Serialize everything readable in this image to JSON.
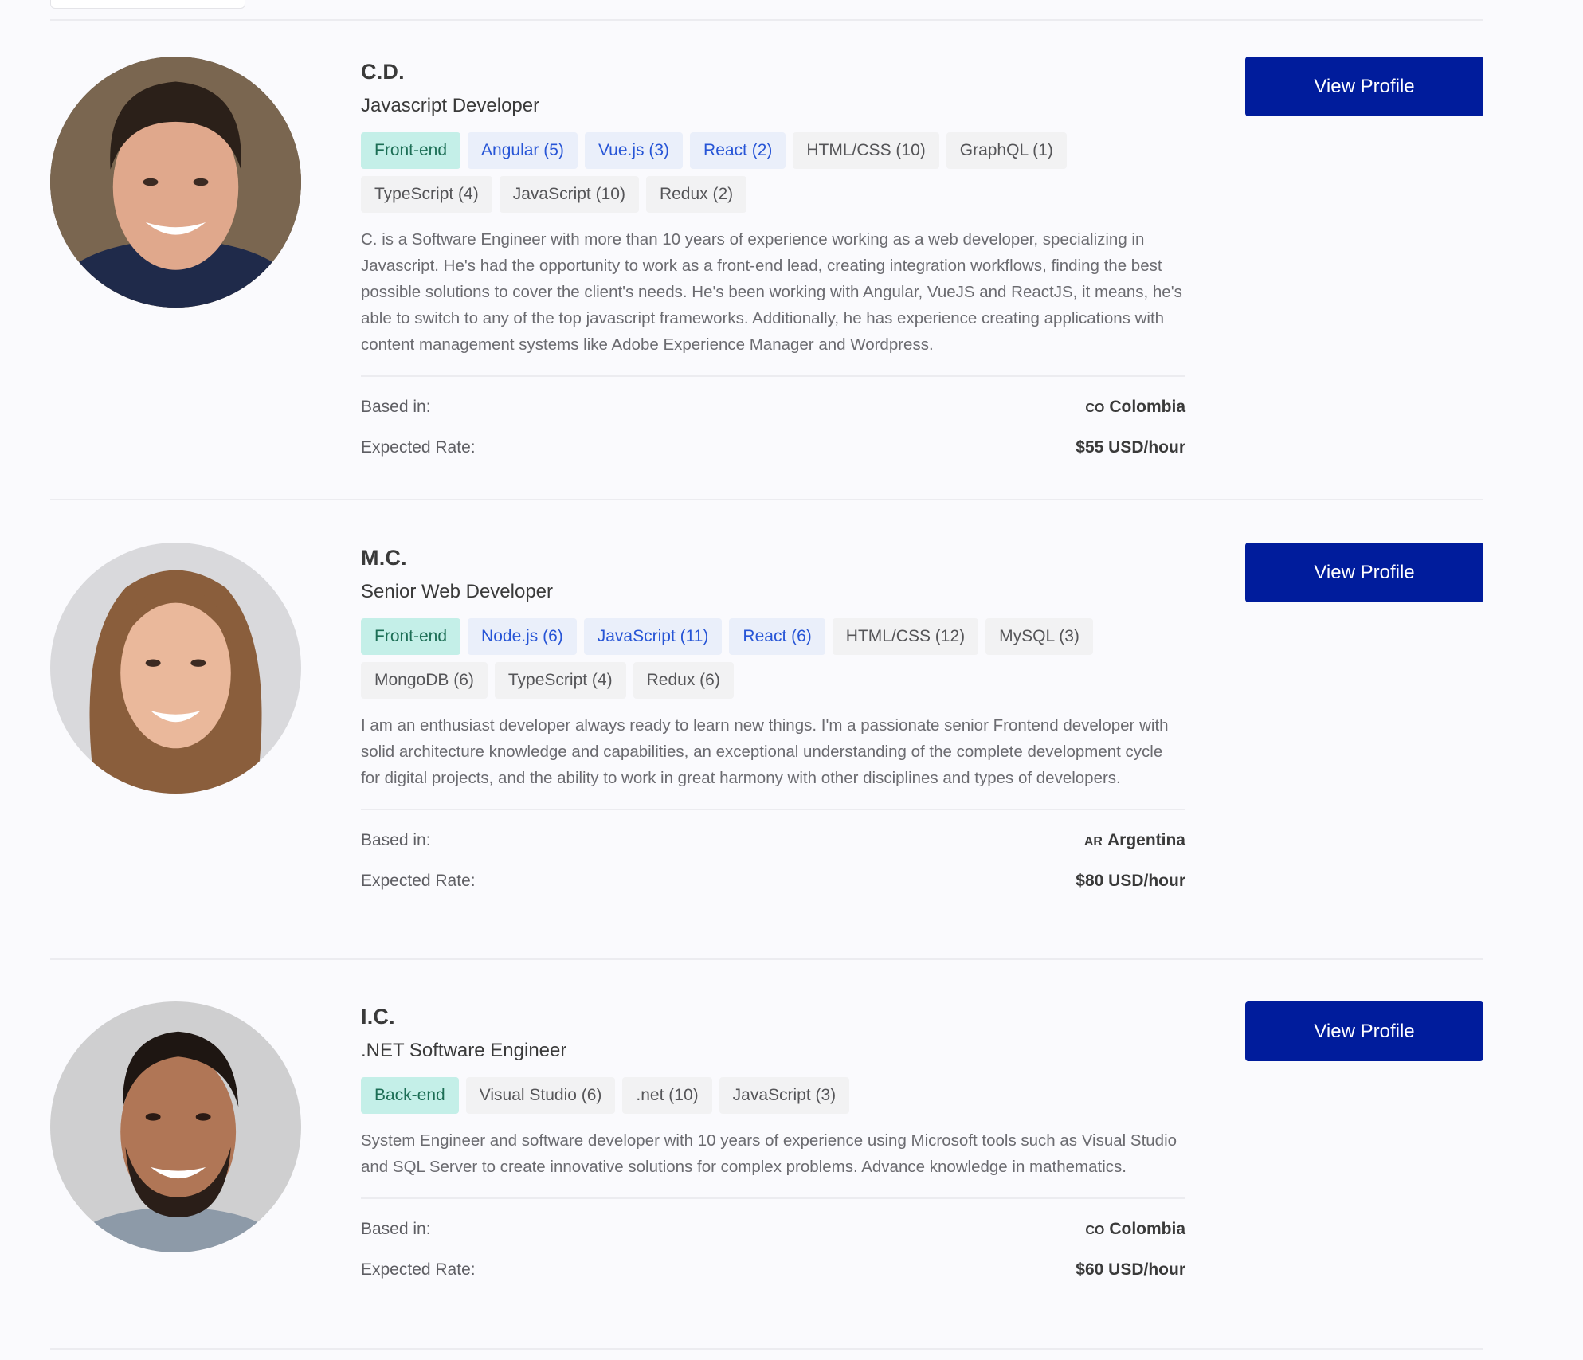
{
  "colors": {
    "button_bg": "#001c9c",
    "category_tag_bg": "#c4efe8",
    "category_tag_text": "#1c6e55",
    "highlight_tag_bg": "#eaeffa",
    "highlight_tag_text": "#2755d6",
    "standard_tag_bg": "#f2f2f3"
  },
  "labels": {
    "based_in": "Based in:",
    "expected_rate": "Expected Rate:",
    "view_profile": "View Profile"
  },
  "candidates": [
    {
      "name": "C.D.",
      "title": "Javascript Developer",
      "avatar": "avatar-photo-man-dark-hair",
      "tags": [
        {
          "label": "Front-end",
          "kind": "cat"
        },
        {
          "label": "Angular (5)",
          "kind": "hl"
        },
        {
          "label": "Vue.js (3)",
          "kind": "hl"
        },
        {
          "label": "React (2)",
          "kind": "hl"
        },
        {
          "label": "HTML/CSS (10)",
          "kind": "std"
        },
        {
          "label": "GraphQL (1)",
          "kind": "std"
        },
        {
          "label": "TypeScript (4)",
          "kind": "std"
        },
        {
          "label": "JavaScript (10)",
          "kind": "std"
        },
        {
          "label": "Redux (2)",
          "kind": "std"
        }
      ],
      "bio": "C. is a Software Engineer with more than 10 years of experience working as a web developer, specializing in Javascript. He's had the opportunity to work as a front-end lead, creating integration workflows, finding the best possible solutions to cover the client's needs. He's been working with Angular, VueJS and ReactJS, it means, he's able to switch to any of the top javascript frameworks. Additionally, he has experience creating applications with content management systems like Adobe Experience Manager and Wordpress.",
      "country_code": "CO",
      "country": "Colombia",
      "rate": "$55 USD/hour"
    },
    {
      "name": "M.C.",
      "title": "Senior Web Developer",
      "avatar": "avatar-photo-woman-brown-hair",
      "tags": [
        {
          "label": "Front-end",
          "kind": "cat"
        },
        {
          "label": "Node.js (6)",
          "kind": "hl"
        },
        {
          "label": "JavaScript (11)",
          "kind": "hl"
        },
        {
          "label": "React (6)",
          "kind": "hl"
        },
        {
          "label": "HTML/CSS (12)",
          "kind": "std"
        },
        {
          "label": "MySQL (3)",
          "kind": "std"
        },
        {
          "label": "MongoDB (6)",
          "kind": "std"
        },
        {
          "label": "TypeScript (4)",
          "kind": "std"
        },
        {
          "label": "Redux (6)",
          "kind": "std"
        }
      ],
      "bio": "I am an enthusiast developer always ready to learn new things. I'm a passionate senior Frontend developer with solid architecture knowledge and capabilities, an exceptional understanding of the complete development cycle for digital projects, and the ability to work in great harmony with other disciplines and types of developers.",
      "country_code": "AR",
      "country": "Argentina",
      "rate": "$80 USD/hour"
    },
    {
      "name": "I.C.",
      "title": ".NET Software Engineer",
      "avatar": "avatar-photo-man-beard",
      "tags": [
        {
          "label": "Back-end",
          "kind": "cat"
        },
        {
          "label": "Visual Studio (6)",
          "kind": "std"
        },
        {
          "label": ".net (10)",
          "kind": "std"
        },
        {
          "label": "JavaScript (3)",
          "kind": "std"
        }
      ],
      "bio": "System Engineer and software developer with 10 years of experience using Microsoft tools such as Visual Studio and SQL Server to create innovative solutions for complex problems. Advance knowledge in mathematics.",
      "country_code": "CO",
      "country": "Colombia",
      "rate": "$60 USD/hour"
    }
  ]
}
